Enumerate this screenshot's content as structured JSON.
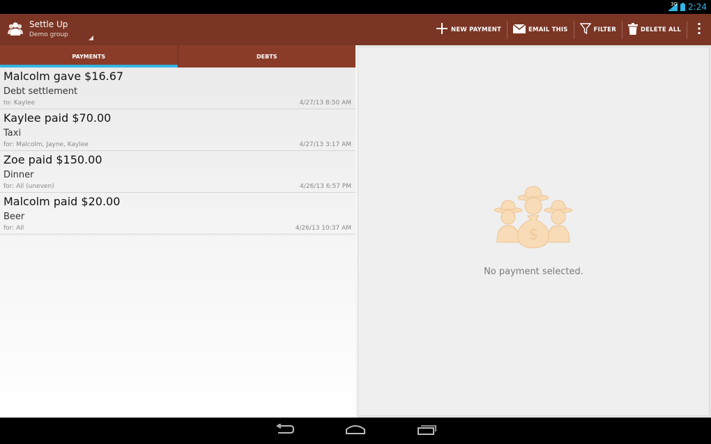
{
  "status_bar": {
    "network": "3G",
    "time": "2:24"
  },
  "app": {
    "title": "Settle Up",
    "subtitle": "Demo group"
  },
  "actions": [
    {
      "label": "NEW PAYMENT",
      "icon": "plus-icon"
    },
    {
      "label": "EMAIL THIS",
      "icon": "email-icon"
    },
    {
      "label": "FILTER",
      "icon": "filter-icon"
    },
    {
      "label": "DELETE ALL",
      "icon": "trash-icon"
    }
  ],
  "tabs": [
    {
      "label": "PAYMENTS",
      "selected": true
    },
    {
      "label": "DEBTS",
      "selected": false
    }
  ],
  "payments": [
    {
      "title": "Malcolm gave $16.67",
      "description": "Debt settlement",
      "sub": "to: Kaylee",
      "date": "4/27/13 8:50 AM"
    },
    {
      "title": "Kaylee paid $70.00",
      "description": "Taxi",
      "sub": "for: Malcolm, Jayne, Kaylee",
      "date": "4/27/13 3:17 AM"
    },
    {
      "title": "Zoe paid $150.00",
      "description": "Dinner",
      "sub": "for: All (uneven)",
      "date": "4/26/13 6:57 PM"
    },
    {
      "title": "Malcolm paid $20.00",
      "description": "Beer",
      "sub": "for: All",
      "date": "4/26/13 10:37 AM"
    }
  ],
  "detail": {
    "empty_message": "No payment selected."
  },
  "colors": {
    "actionbar": "#7a3524",
    "tabs": "#8a3c29",
    "accent": "#33b5e5"
  }
}
